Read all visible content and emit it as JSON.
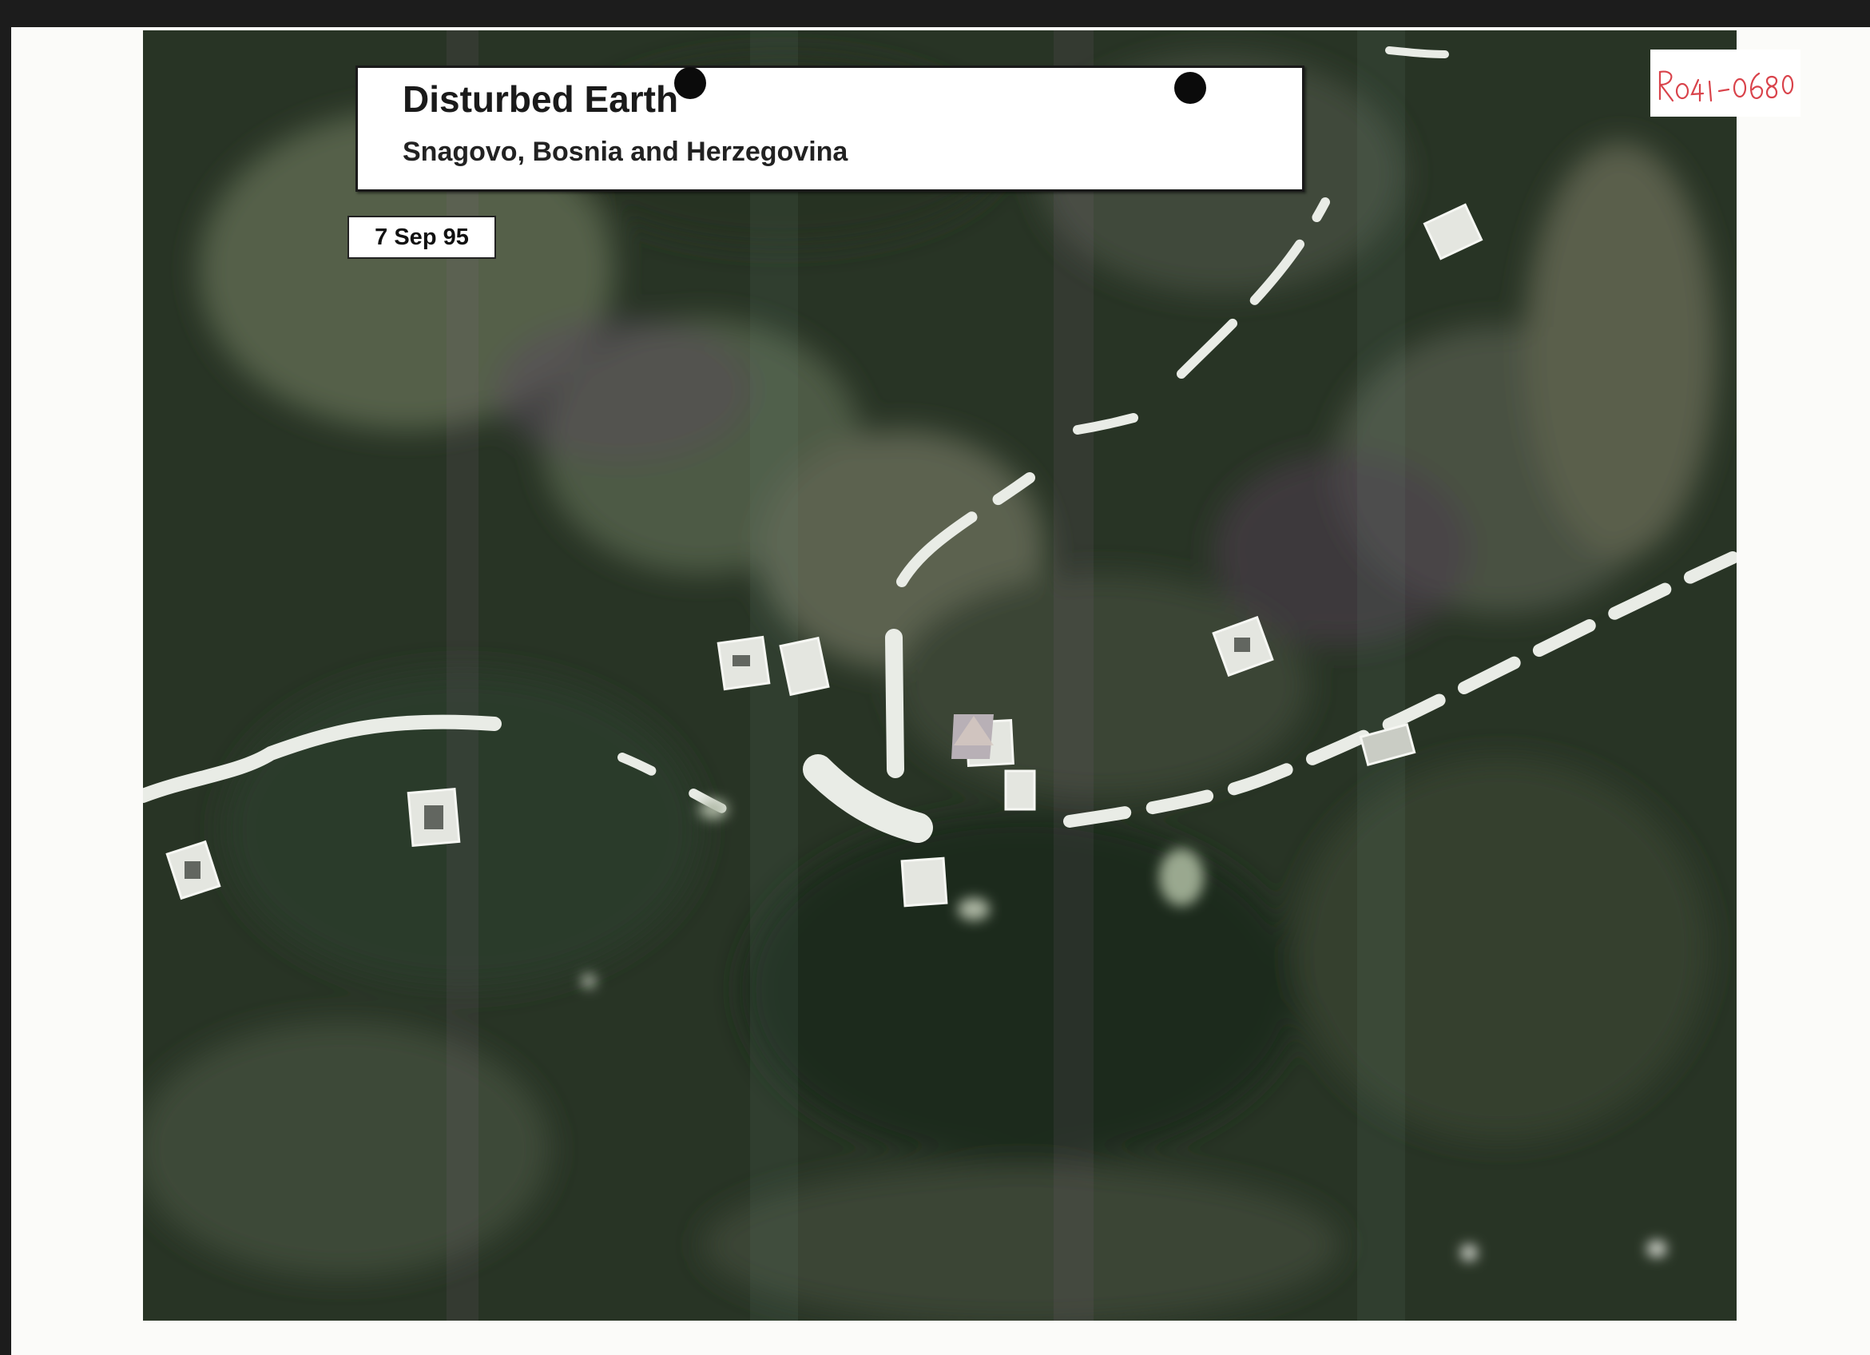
{
  "document": {
    "title": "Disturbed Earth",
    "subtitle": "Snagovo, Bosnia and Herzegovina",
    "date": "7 Sep 95",
    "stamp_text": "R041-0680"
  },
  "image": {
    "content": "aerial-photograph",
    "colors": {
      "background": "#1c1c1c",
      "paper": "#fbfbf9",
      "vegetation_dark": "#23311f",
      "vegetation_light": "#5f6c52",
      "road": "#e9ece6",
      "stamp_ink": "#d9434b"
    }
  }
}
